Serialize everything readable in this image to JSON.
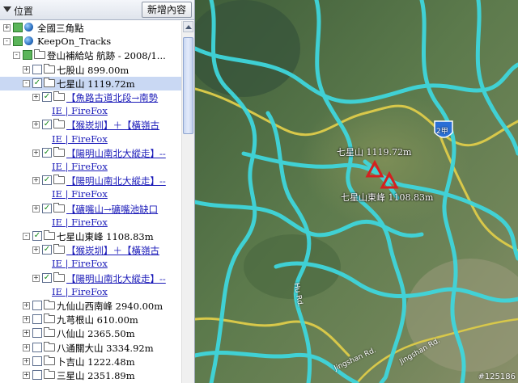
{
  "panel": {
    "title": "位置",
    "add_button": "新增內容"
  },
  "tree": [
    {
      "label": "全國三角點",
      "link": "",
      "expander": "+",
      "checkbox": "green",
      "icon": "globe",
      "indent": 0
    },
    {
      "label": "KeepOn_Tracks",
      "link": "",
      "expander": "-",
      "checkbox": "green",
      "icon": "globe",
      "indent": 0
    },
    {
      "label": "登山補給站 航跡 - 2008/1...",
      "link": "",
      "expander": "-",
      "checkbox": "green",
      "icon": "folder",
      "indent": 1
    },
    {
      "label": "七股山 899.00m",
      "link": "",
      "expander": "+",
      "checkbox": "empty",
      "icon": "folder",
      "indent": 2
    },
    {
      "label": "七星山 1119.72m",
      "link": "",
      "expander": "-",
      "checkbox": "checked",
      "icon": "folder",
      "indent": 2,
      "selected": true
    },
    {
      "label": "",
      "link": "【魚路古道北段→南勢",
      "expander": "+",
      "checkbox": "checked",
      "icon": "folder",
      "indent": 3
    },
    {
      "label": "",
      "link": "IE | FireFox",
      "expander": "",
      "checkbox": "",
      "icon": "",
      "indent": 4
    },
    {
      "label": "",
      "link": "【猴崁圳】＋【橫嶺古",
      "expander": "+",
      "checkbox": "checked",
      "icon": "folder",
      "indent": 3
    },
    {
      "label": "",
      "link": "IE | FireFox",
      "expander": "",
      "checkbox": "",
      "icon": "",
      "indent": 4
    },
    {
      "label": "",
      "link": "【陽明山南北大縱走】--",
      "expander": "+",
      "checkbox": "checked",
      "icon": "folder",
      "indent": 3
    },
    {
      "label": "",
      "link": "IE | FireFox",
      "expander": "",
      "checkbox": "",
      "icon": "",
      "indent": 4
    },
    {
      "label": "",
      "link": "【陽明山南北大縱走】--",
      "expander": "+",
      "checkbox": "checked",
      "icon": "folder",
      "indent": 3
    },
    {
      "label": "",
      "link": "IE | FireFox",
      "expander": "",
      "checkbox": "",
      "icon": "",
      "indent": 4
    },
    {
      "label": "",
      "link": "【礦嘴山→礦嘴池缺口",
      "expander": "+",
      "checkbox": "checked",
      "icon": "folder",
      "indent": 3
    },
    {
      "label": "",
      "link": "IE | FireFox",
      "expander": "",
      "checkbox": "",
      "icon": "",
      "indent": 4
    },
    {
      "label": "七星山東峰 1108.83m",
      "link": "",
      "expander": "-",
      "checkbox": "checked",
      "icon": "folder",
      "indent": 2
    },
    {
      "label": "",
      "link": "【猴崁圳】＋【橫嶺古",
      "expander": "+",
      "checkbox": "checked",
      "icon": "folder",
      "indent": 3
    },
    {
      "label": "",
      "link": "IE | FireFox",
      "expander": "",
      "checkbox": "",
      "icon": "",
      "indent": 4
    },
    {
      "label": "",
      "link": "【陽明山南北大縱走】--",
      "expander": "+",
      "checkbox": "checked",
      "icon": "folder",
      "indent": 3
    },
    {
      "label": "",
      "link": "IE | FireFox",
      "expander": "",
      "checkbox": "",
      "icon": "",
      "indent": 4
    },
    {
      "label": "九仙山西南峰 2940.00m",
      "link": "",
      "expander": "+",
      "checkbox": "empty",
      "icon": "folder",
      "indent": 2
    },
    {
      "label": "九芎根山 610.00m",
      "link": "",
      "expander": "+",
      "checkbox": "empty",
      "icon": "folder",
      "indent": 2
    },
    {
      "label": "八仙山 2365.50m",
      "link": "",
      "expander": "+",
      "checkbox": "empty",
      "icon": "folder",
      "indent": 2
    },
    {
      "label": "八通關大山 3334.92m",
      "link": "",
      "expander": "+",
      "checkbox": "empty",
      "icon": "folder",
      "indent": 2
    },
    {
      "label": "卜吉山 1222.48m",
      "link": "",
      "expander": "+",
      "checkbox": "empty",
      "icon": "folder",
      "indent": 2
    },
    {
      "label": "三星山 2351.89m",
      "link": "",
      "expander": "+",
      "checkbox": "empty",
      "icon": "folder",
      "indent": 2
    }
  ],
  "map": {
    "peak1_label": "七星山 1119.72m",
    "peak2_label": "七星山東峰 1108.83m",
    "shield_label": "2甲",
    "road_labels": [
      "Jingshan Rd.",
      "Jingshan Rd.",
      "Hu Rd."
    ],
    "watermark": "#125186",
    "track_color": "#3fd6dc",
    "road_color": "#d8c84a",
    "peak_color": "#d42020"
  }
}
